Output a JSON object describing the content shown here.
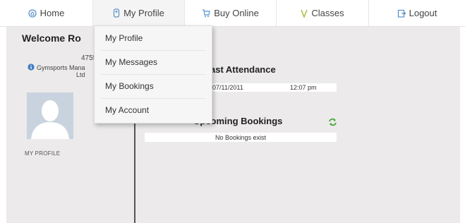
{
  "nav": {
    "home": "Home",
    "my_profile": "My Profile",
    "buy_online": "Buy Online",
    "classes": "Classes",
    "logout": "Logout"
  },
  "sidebar": {
    "welcome": "Welcome Ro",
    "member_id": "4755",
    "org_line1": "Gymsports Mana",
    "org_line2": "Ltd",
    "profile_link": "MY PROFILE"
  },
  "attendance": {
    "title": "ast Attendance",
    "date": "07/11/2011",
    "time": "12:07 pm"
  },
  "bookings": {
    "title": "Upcoming Bookings",
    "empty_text": "No Bookings exist"
  },
  "dropdown": {
    "items": [
      "My Profile",
      "My Messages",
      "My Bookings",
      "My Account"
    ]
  },
  "colors": {
    "nav_icon": "#5a8fc7",
    "buy_icon": "#6fa3d6",
    "classes_icon": "#a6c24a",
    "refresh_icon": "#49a83c"
  }
}
